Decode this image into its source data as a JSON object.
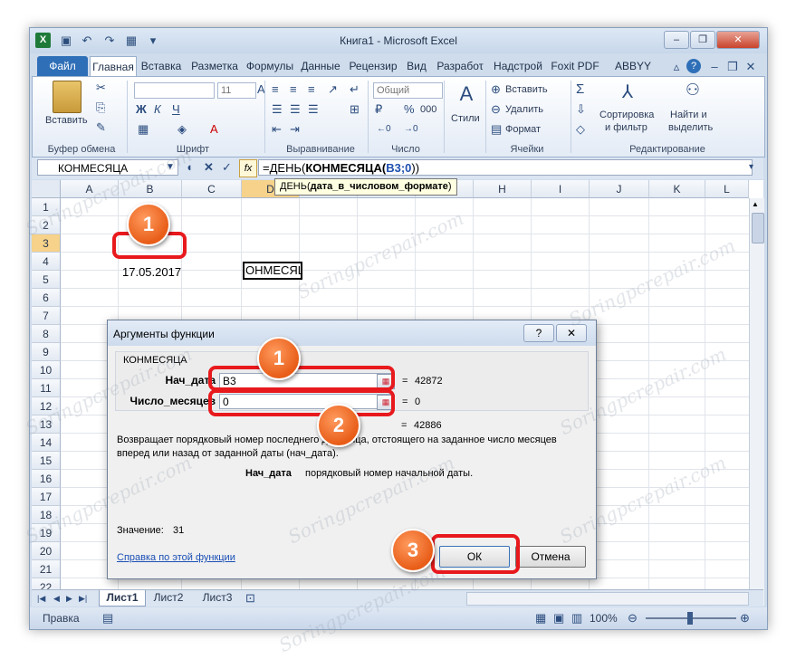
{
  "window": {
    "title": "Книга1  -  Microsoft Excel",
    "controls": {
      "minimize": "–",
      "restore": "❐",
      "close": "✕"
    }
  },
  "ribbon_tabs": [
    {
      "label": "Файл"
    },
    {
      "label": "Главная"
    },
    {
      "label": "Вставка"
    },
    {
      "label": "Разметка"
    },
    {
      "label": "Формулы"
    },
    {
      "label": "Данные"
    },
    {
      "label": "Рецензир"
    },
    {
      "label": "Вид"
    },
    {
      "label": "Разрабоτ"
    },
    {
      "label": "Надстрой"
    },
    {
      "label": "Foxit PDF"
    },
    {
      "label": "ABBYY PDF"
    }
  ],
  "ribbon": {
    "clipboard": {
      "label": "Буфер обмена",
      "paste": "Вставить"
    },
    "font": {
      "label": "Шрифт",
      "size": "11",
      "bold": "Ж",
      "italic": "К",
      "underline": "Ч"
    },
    "alignment": {
      "label": "Выравнивание"
    },
    "number": {
      "label": "Число",
      "format": "Общий",
      "percent": "%",
      "thousands": "000"
    },
    "styles": {
      "label": "Стили"
    },
    "cells": {
      "label": "Ячейки",
      "insert": "Вставить",
      "delete": "Удалить",
      "format": "Формат"
    },
    "editing": {
      "label": "Редактирование",
      "sort": "Сортировка",
      "sort2": "и фильтр",
      "find": "Найти и",
      "find2": "выделить",
      "sum": "Σ"
    }
  },
  "formula_bar": {
    "name_box": "КОНМЕСЯЦА",
    "fx": "fx",
    "formula_prefix": "=ДЕНЬ(",
    "formula_bold": "КОНМЕСЯЦА",
    "formula_paren": "(",
    "formula_arg": "B3;0",
    "formula_suffix": "))",
    "tooltip_fn": "ДЕНЬ(",
    "tooltip_arg": "дата_в_числовом_формате",
    "tooltip_end": ")"
  },
  "grid": {
    "columns": [
      "A",
      "B",
      "C",
      "D",
      "E",
      "F",
      "G",
      "H",
      "I",
      "J",
      "K",
      "L"
    ],
    "rows": [
      "1",
      "2",
      "3",
      "4",
      "5",
      "6",
      "7",
      "8",
      "9",
      "10",
      "11",
      "12",
      "13",
      "14",
      "15",
      "16",
      "17",
      "18",
      "19",
      "20",
      "21",
      "22"
    ],
    "cell_B3": "17.05.2017",
    "cell_D3": "ОНМЕСЯЦ"
  },
  "dialog": {
    "title": "Аргументы функции",
    "help_btn": "?",
    "close_btn": "✕",
    "function_name": "КОНМЕСЯЦА",
    "args": [
      {
        "label": "Нач_дата",
        "value": "B3",
        "result": "42872"
      },
      {
        "label": "Число_месяцев",
        "value": "0",
        "result": "0"
      }
    ],
    "equals": "=",
    "total_result": "42886",
    "description_1": "Возвращает порядковый номер последнего д        яца, отстоящего на заданное число месяцев",
    "description_2": "вперед или назад от заданной даты (нач_дата).",
    "arg_help_label": "Нач_дата",
    "arg_help_text": "порядковый номер начальной даты.",
    "value_label": "Значение:",
    "value": "31",
    "help_link": "Справка по этой функции",
    "ok": "ОК",
    "cancel": "Отмена"
  },
  "sheets": [
    {
      "label": "Лист1"
    },
    {
      "label": "Лист2"
    },
    {
      "label": "Лист3"
    }
  ],
  "status": {
    "mode": "Правка",
    "zoom": "100%"
  },
  "badges": {
    "b1": "1",
    "b2": "1",
    "b3": "2",
    "b4": "3"
  },
  "watermark": "Soringpcrepair.com",
  "colors": {
    "accent": "#2f6fb7",
    "highlight": "#e8191d",
    "badge": "#e85d18"
  }
}
